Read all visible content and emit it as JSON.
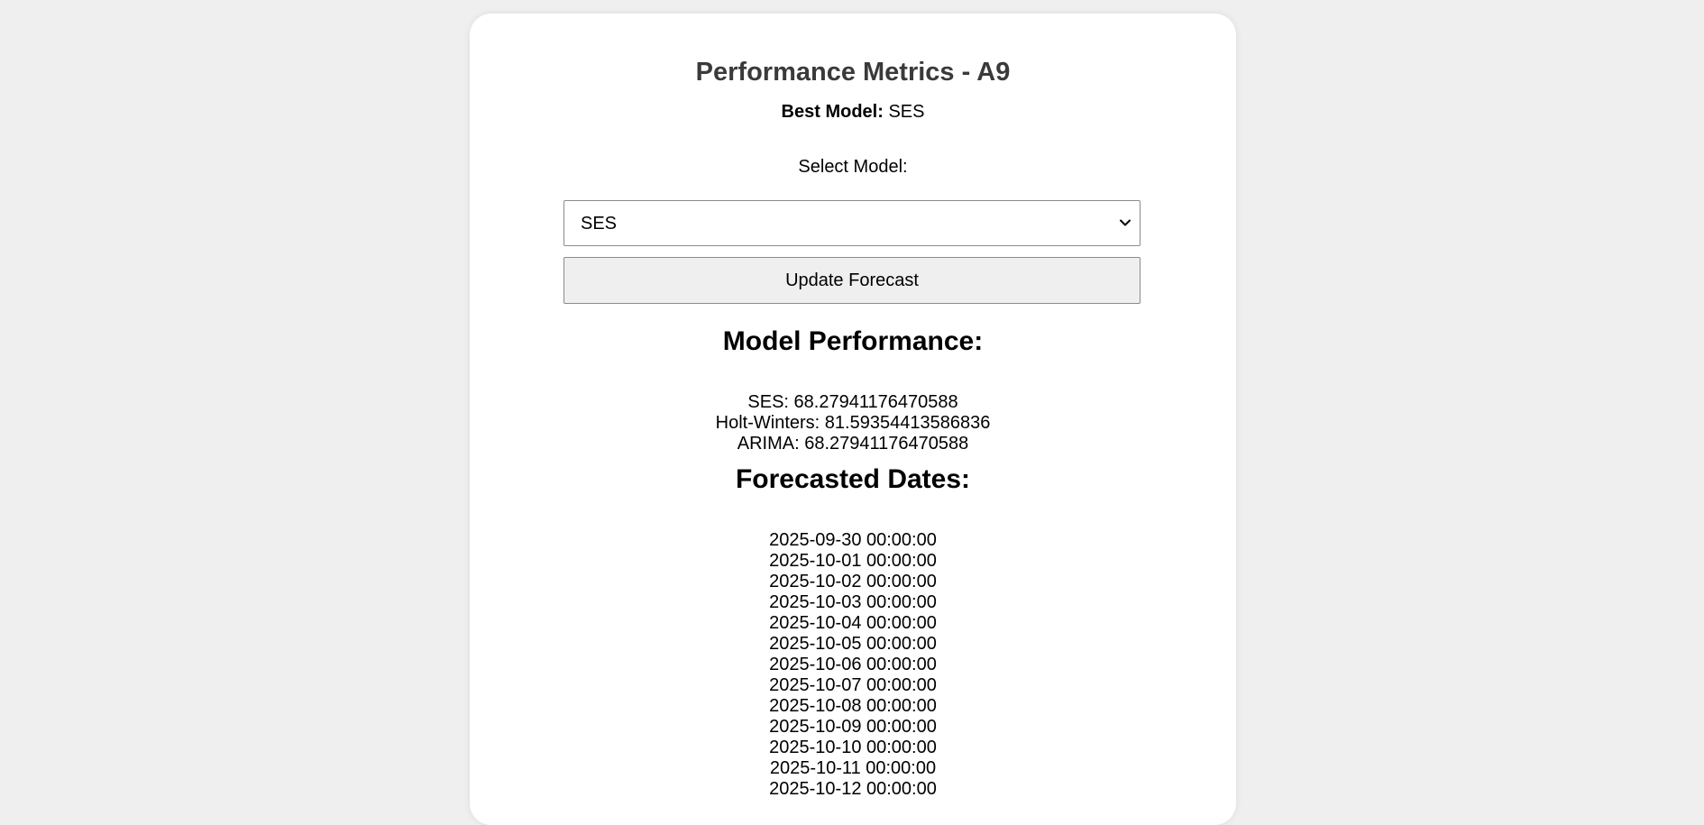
{
  "page": {
    "title": "Performance Metrics - A9",
    "best_model_label": "Best Model:",
    "best_model_value": "SES",
    "select_label": "Select Model:",
    "selected_model": "SES",
    "update_button": "Update Forecast",
    "performance_heading": "Model Performance:",
    "performance": [
      "SES: 68.27941176470588",
      "Holt-Winters: 81.59354413586836",
      "ARIMA: 68.27941176470588"
    ],
    "dates_heading": "Forecasted Dates:",
    "dates": [
      "2025-09-30 00:00:00",
      "2025-10-01 00:00:00",
      "2025-10-02 00:00:00",
      "2025-10-03 00:00:00",
      "2025-10-04 00:00:00",
      "2025-10-05 00:00:00",
      "2025-10-06 00:00:00",
      "2025-10-07 00:00:00",
      "2025-10-08 00:00:00",
      "2025-10-09 00:00:00",
      "2025-10-10 00:00:00",
      "2025-10-11 00:00:00",
      "2025-10-12 00:00:00"
    ]
  },
  "colors": {
    "background": "#efefef",
    "card": "#ffffff",
    "title": "#3a3a3a",
    "button_bg": "#efefef",
    "border": "#8a8a8a"
  },
  "icons": {
    "select_arrow": "chevron-down-icon"
  }
}
